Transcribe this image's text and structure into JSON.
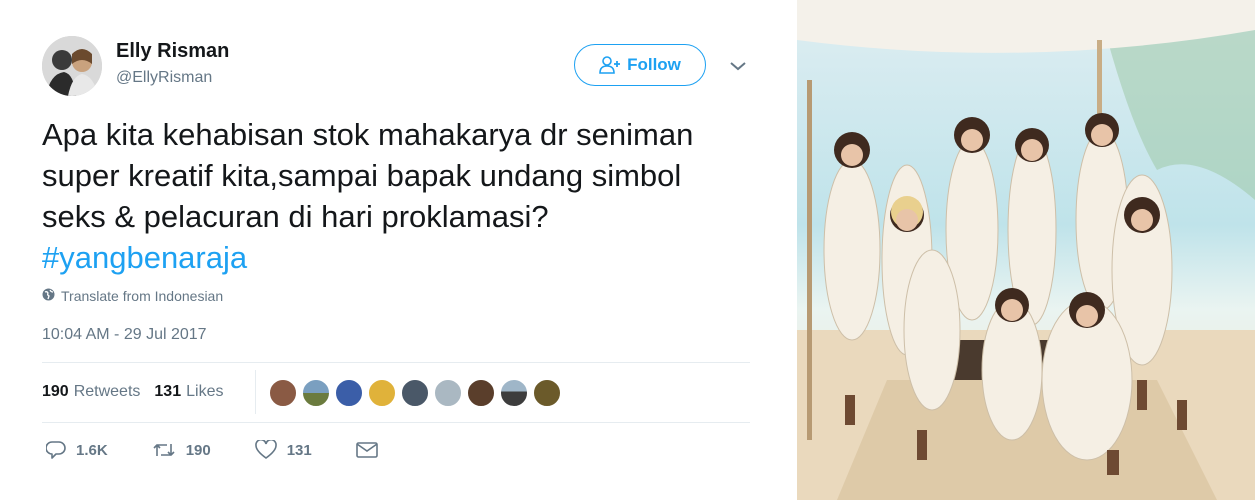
{
  "author": {
    "name": "Elly Risman",
    "handle": "@EllyRisman"
  },
  "follow_button": {
    "label": "Follow",
    "icon": "add-user-icon",
    "color": "#1da1f2"
  },
  "tweet": {
    "text": "Apa kita kehabisan stok mahakarya dr seniman super kreatif kita,sampai bapak undang simbol seks & pelacuran di hari proklamasi?",
    "hashtag": "#yangbenaraja",
    "translate_label": "Translate from Indonesian",
    "timestamp": "10:04 AM - 29 Jul 2017"
  },
  "stats": {
    "retweets_count": "190",
    "retweets_label": "Retweets",
    "likes_count": "131",
    "likes_label": "Likes"
  },
  "actions": {
    "reply_count": "1.6K",
    "retweet_count": "190",
    "like_count": "131"
  },
  "colors": {
    "link": "#1da1f2",
    "secondary_text": "#657786",
    "primary_text": "#14171a"
  }
}
